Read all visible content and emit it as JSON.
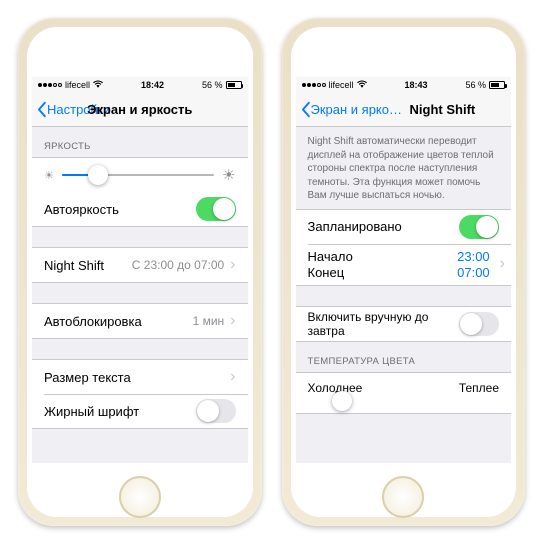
{
  "phone1": {
    "status": {
      "carrier": "lifecell",
      "time": "18:42",
      "battery": "56 %"
    },
    "nav": {
      "back": "Настройки",
      "title": "Экран и яркость"
    },
    "brightness": {
      "header": "ЯРКОСТЬ",
      "slider_pct": 24
    },
    "rows": {
      "autobrightness": {
        "label": "Автояркость",
        "on": true
      },
      "nightshift": {
        "label": "Night Shift",
        "detail": "С 23:00 до 07:00"
      },
      "autolock": {
        "label": "Автоблокировка",
        "detail": "1 мин"
      },
      "textsize": {
        "label": "Размер текста"
      },
      "bold": {
        "label": "Жирный шрифт",
        "on": false
      }
    }
  },
  "phone2": {
    "status": {
      "carrier": "lifecell",
      "time": "18:43",
      "battery": "56 %"
    },
    "nav": {
      "back": "Экран и яркость",
      "title": "Night Shift"
    },
    "desc": "Night Shift автоматически переводит дисплей на отображение цветов теплой стороны спектра после наступления темноты. Эта функция может помочь Вам лучше выспаться ночью.",
    "rows": {
      "scheduled": {
        "label": "Запланировано",
        "on": true
      },
      "start_label": "Начало",
      "start_value": "23:00",
      "end_label": "Конец",
      "end_value": "07:00",
      "manual": {
        "label": "Включить вручную до завтра",
        "on": false
      }
    },
    "temp": {
      "header": "ТЕМПЕРАТУРА ЦВЕТА",
      "cold": "Холоднее",
      "warm": "Теплее",
      "slider_pct": 18
    }
  }
}
